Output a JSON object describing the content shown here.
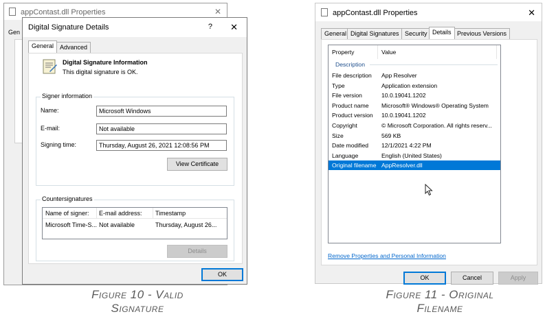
{
  "left": {
    "background_window": {
      "title": "appContast.dll Properties",
      "tab_fragment": "Gen",
      "close_glyph": "✕"
    },
    "dialog": {
      "title": "Digital Signature Details",
      "help_glyph": "?",
      "close_glyph": "✕",
      "tabs": [
        "General",
        "Advanced"
      ],
      "active_tab": "General",
      "info_heading": "Digital Signature Information",
      "info_text": "This digital signature is OK.",
      "signer_group_title": "Signer information",
      "name_label": "Name:",
      "name_value": "Microsoft Windows",
      "email_label": "E-mail:",
      "email_value": "Not available",
      "signing_time_label": "Signing time:",
      "signing_time_value": "Thursday, August 26, 2021 12:08:56 PM",
      "view_certificate_label": "View Certificate",
      "countersig_group_title": "Countersignatures",
      "countersig_columns": [
        "Name of signer:",
        "E-mail address:",
        "Timestamp"
      ],
      "countersig_rows": [
        [
          "Microsoft Time-S...",
          "Not available",
          "Thursday, August 26..."
        ]
      ],
      "details_label": "Details",
      "ok_label": "OK"
    },
    "caption_line1": "Figure 10 - Valid",
    "caption_line2": "Signature"
  },
  "right": {
    "window": {
      "title": "appContast.dll Properties",
      "close_glyph": "✕",
      "tabs": [
        "General",
        "Digital Signatures",
        "Security",
        "Details",
        "Previous Versions"
      ],
      "active_tab": "Details",
      "list_header": [
        "Property",
        "Value"
      ],
      "section_label": "Description",
      "rows": [
        {
          "k": "File description",
          "v": "App Resolver"
        },
        {
          "k": "Type",
          "v": "Application extension"
        },
        {
          "k": "File version",
          "v": "10.0.19041.1202"
        },
        {
          "k": "Product name",
          "v": "Microsoft® Windows® Operating System"
        },
        {
          "k": "Product version",
          "v": "10.0.19041.1202"
        },
        {
          "k": "Copyright",
          "v": "© Microsoft Corporation. All rights reserv..."
        },
        {
          "k": "Size",
          "v": "569 KB"
        },
        {
          "k": "Date modified",
          "v": "12/1/2021 4:22 PM"
        },
        {
          "k": "Language",
          "v": "English (United States)"
        },
        {
          "k": "Original filename",
          "v": "AppResolver.dll"
        }
      ],
      "selected_row": "Original filename",
      "remove_link": "Remove Properties and Personal Information",
      "ok_label": "OK",
      "cancel_label": "Cancel",
      "apply_label": "Apply"
    },
    "caption_line1": "Figure 11 - Original",
    "caption_line2": "Filename"
  }
}
